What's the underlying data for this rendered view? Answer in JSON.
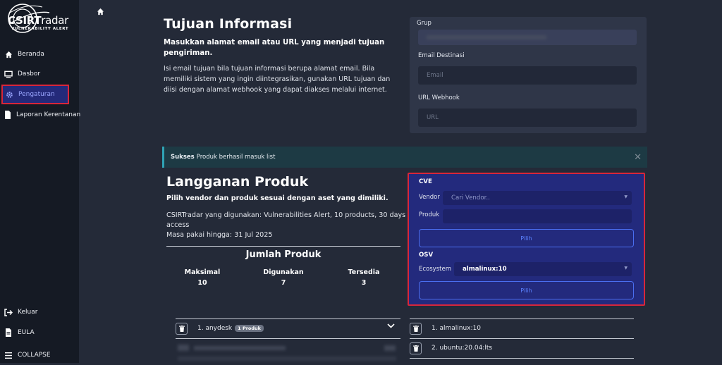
{
  "sidebar": {
    "logo_brand_bold": "CSIRT",
    "logo_brand_light": "radar",
    "logo_tagline": "VULNERABILITY ALERT",
    "items": [
      {
        "label": "Beranda",
        "icon": "home-icon"
      },
      {
        "label": "Dasbor",
        "icon": "monitor-icon"
      },
      {
        "label": "Pengaturan",
        "icon": "gear-icon"
      },
      {
        "label": "Laporan Kerentanan",
        "icon": "file-icon"
      }
    ],
    "bottom_items": [
      {
        "label": "Keluar",
        "icon": "logout-icon"
      },
      {
        "label": "EULA",
        "icon": "document-icon"
      },
      {
        "label": "COLLAPSE",
        "icon": "menu-icon"
      }
    ],
    "active_color": "#242a7a",
    "highlight_color": "#d8263a"
  },
  "info": {
    "title": "Tujuan Informasi",
    "subtitle": "Masukkan alamat email atau URL yang menjadi tujuan pengiriman.",
    "description": "Isi email tujuan bila tujuan informasi berupa alamat email. Bila memiliki sistem yang ingin diintegrasikan, gunakan URL tujuan dan diisi dengan alamat webhook yang dapat diakses melalui internet.",
    "form": {
      "group_label": "Grup",
      "email_label": "Email Destinasi",
      "email_placeholder": "Email",
      "url_label": "URL Webhook",
      "url_placeholder": "URL"
    }
  },
  "alert": {
    "strong": "Sukses",
    "message": "Produk berhasil masuk list"
  },
  "subscription": {
    "title": "Langganan Produk",
    "subtitle": "Pilih vendor dan produk sesuai dengan aset yang dimiliki.",
    "plan": "CSIRTradar yang digunakan: Vulnerabilities Alert, 10 products, 30 days access",
    "expiry": "Masa pakai hingga: 31 Jul 2025",
    "count_title": "Jumlah Produk",
    "stats": [
      {
        "label": "Maksimal",
        "value": "10"
      },
      {
        "label": "Digunakan",
        "value": "7"
      },
      {
        "label": "Tersedia",
        "value": "3"
      }
    ]
  },
  "picker": {
    "cve_title": "CVE",
    "vendor_label": "Vendor",
    "vendor_placeholder": "Cari Vendor..",
    "product_label": "Produk",
    "button_label": "Pilih",
    "osv_title": "OSV",
    "ecosystem_label": "Ecosystem",
    "ecosystem_value": "almalinux:10",
    "button2_label": "Pilih"
  },
  "cve_list": [
    {
      "label": "1. anydesk",
      "badge": "1 Produk"
    }
  ],
  "osv_list": [
    {
      "label": "1. almalinux:10"
    },
    {
      "label": "2. ubuntu:20.04:lts"
    }
  ]
}
